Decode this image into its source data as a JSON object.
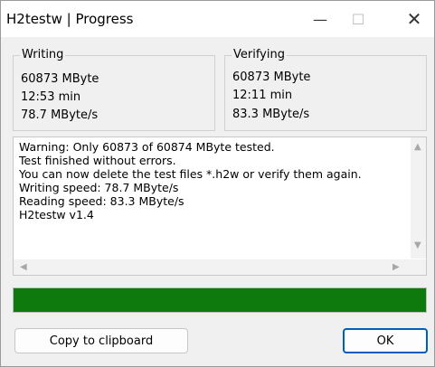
{
  "window": {
    "title": "H2testw | Progress",
    "controls": {
      "minimize": "—",
      "maximize": "☐",
      "close": "✕"
    }
  },
  "writing": {
    "label": "Writing",
    "size": "60873 MByte",
    "time": "12:53 min",
    "speed": "78.7 MByte/s"
  },
  "verifying": {
    "label": "Verifying",
    "size": "60873 MByte",
    "time": "12:11 min",
    "speed": "83.3 MByte/s"
  },
  "log": {
    "text": "Warning: Only 60873 of 60874 MByte tested.\nTest finished without errors.\nYou can now delete the test files *.h2w or verify them again.\nWriting speed: 78.7 MByte/s\nReading speed: 83.3 MByte/s\nH2testw v1.4"
  },
  "progress": {
    "percent": 100,
    "color": "#0e7a0e"
  },
  "buttons": {
    "copy": "Copy to clipboard",
    "ok": "OK"
  },
  "colors": {
    "accent": "#005fb8"
  }
}
